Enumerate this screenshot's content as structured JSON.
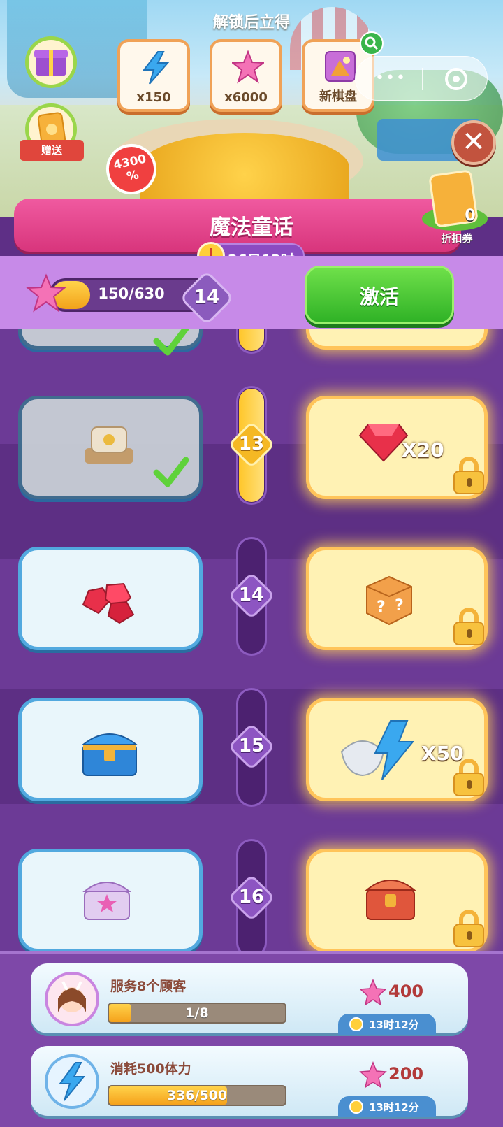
{
  "header": {
    "unlock_title": "解锁后立得",
    "rewards": [
      {
        "label": "x150",
        "icon": "energy-bolt-icon"
      },
      {
        "label": "x6000",
        "icon": "pink-star-icon"
      },
      {
        "label": "新棋盘",
        "icon": "new-board-icon"
      }
    ],
    "gift_label": "赠送",
    "bonus_badge": "4300\n%",
    "title": "魔法童话",
    "timer": "26日13时",
    "coupon": {
      "count": "0",
      "label": "折扣券"
    }
  },
  "progress": {
    "current": 150,
    "total": 630,
    "text": "150/630",
    "level": "14",
    "activate_label": "激活"
  },
  "tiers": [
    {
      "level": "13",
      "free_item": "mahjong-tile-icon",
      "free_claimed": true,
      "premium_item": "ruby-icon",
      "premium_qty": "X20",
      "locked": true
    },
    {
      "level": "14",
      "free_item": "ruby-cluster-icon",
      "free_claimed": false,
      "premium_item": "mystery-box-icon",
      "premium_qty": "",
      "locked": true
    },
    {
      "level": "15",
      "free_item": "treasure-chest-icon",
      "free_claimed": false,
      "premium_item": "shell-energy-icon",
      "premium_qty": "X50",
      "locked": true
    },
    {
      "level": "16",
      "free_item": "purple-chest-icon",
      "free_claimed": false,
      "premium_item": "red-chest-icon",
      "premium_qty": "",
      "locked": true
    }
  ],
  "tasks": [
    {
      "name": "服务8个顾客",
      "progress_text": "1/8",
      "progress": 0.125,
      "reward": "400",
      "time": "13时12分",
      "avatar": "girl-avatar-icon"
    },
    {
      "name": "消耗500体力",
      "progress_text": "336/500",
      "progress": 0.672,
      "reward": "200",
      "time": "13时12分",
      "avatar": "energy-bolt-icon"
    }
  ],
  "colors": {
    "accent_pink": "#d8357c",
    "green_button": "#2fb226",
    "purple_bg": "#6c3a96"
  }
}
